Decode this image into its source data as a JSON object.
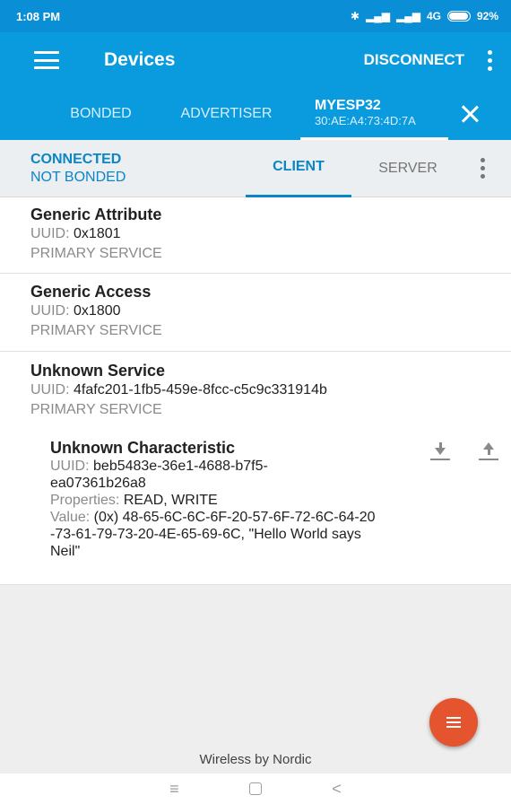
{
  "status_bar": {
    "time": "1:08 PM",
    "network": "4G",
    "battery": "92%"
  },
  "app_bar": {
    "title": "Devices",
    "disconnect_label": "DISCONNECT"
  },
  "tabs": {
    "bonded": "BONDED",
    "advertiser": "ADVERTISER",
    "device_name": "MYESP32",
    "device_mac": "30:AE:A4:73:4D:7A"
  },
  "connection": {
    "state": "CONNECTED",
    "bond": "NOT BONDED"
  },
  "sub_tabs": {
    "client": "CLIENT",
    "server": "SERVER"
  },
  "services": [
    {
      "name": "Generic Attribute",
      "uuid_label": "UUID:",
      "uuid": "0x1801",
      "type": "PRIMARY SERVICE"
    },
    {
      "name": "Generic Access",
      "uuid_label": "UUID:",
      "uuid": "0x1800",
      "type": "PRIMARY SERVICE"
    },
    {
      "name": "Unknown Service",
      "uuid_label": "UUID:",
      "uuid": "4fafc201-1fb5-459e-8fcc-c5c9c331914b",
      "type": "PRIMARY SERVICE"
    }
  ],
  "characteristic": {
    "name": "Unknown Characteristic",
    "uuid_label": "UUID:",
    "uuid_line1": "beb5483e-36e1-4688-b7f5-",
    "uuid_line2": "ea07361b26a8",
    "properties_label": "Properties:",
    "properties": "READ, WRITE",
    "value_label": "Value:",
    "value_line1": "(0x) 48-65-6C-6C-6F-20-57-6F-72-6C-64-20",
    "value_line2": "-73-61-79-73-20-4E-65-69-6C, \"Hello World says",
    "value_line3": "Neil\""
  },
  "footer": "Wireless by Nordic"
}
